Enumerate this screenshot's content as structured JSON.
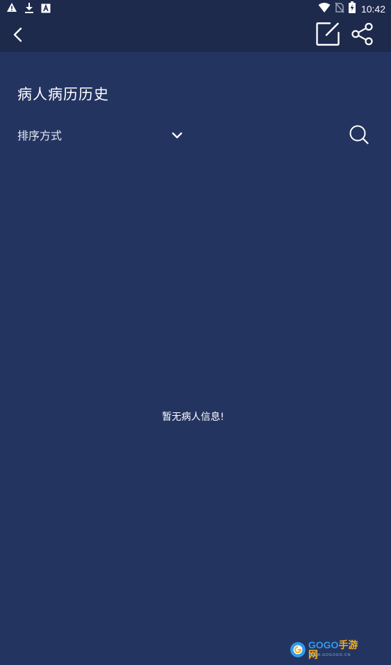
{
  "status_bar": {
    "time": "10:42",
    "left_icons": [
      "warning-icon",
      "download-icon",
      "app-a-icon"
    ],
    "right_icons": [
      "wifi-icon",
      "no-sim-icon",
      "battery-charging-icon"
    ]
  },
  "app_bar": {
    "back_icon": "chevron-left-icon",
    "edit_icon": "edit-square-icon",
    "share_icon": "share-icon"
  },
  "page": {
    "title": "病人病历历史",
    "sort_label": "排序方式",
    "empty_message": "暂无病人信息!"
  },
  "watermark": {
    "brand_part1": "GOGO",
    "brand_part2": "手游网",
    "url": "WWW.GOGOGO.CN"
  },
  "colors": {
    "background": "#243461",
    "app_bar": "#1e2a4c",
    "text": "#ffffff"
  }
}
